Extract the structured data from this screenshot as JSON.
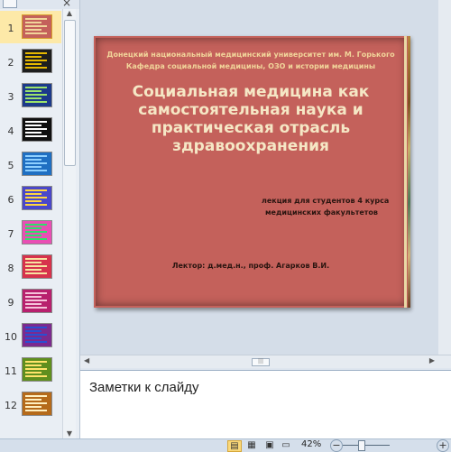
{
  "slides_pane": {
    "close_label": "×",
    "slides": [
      {
        "number": "1",
        "selected": true,
        "colors": [
          "#c4615b",
          "#f1d59a"
        ]
      },
      {
        "number": "2",
        "selected": false,
        "colors": [
          "#1e1e1e",
          "#e6b800"
        ]
      },
      {
        "number": "3",
        "selected": false,
        "colors": [
          "#1c3a8a",
          "#9be36b"
        ]
      },
      {
        "number": "4",
        "selected": false,
        "colors": [
          "#101010",
          "#ffffff"
        ]
      },
      {
        "number": "5",
        "selected": false,
        "colors": [
          "#1f6fc2",
          "#8fd0ff"
        ]
      },
      {
        "number": "6",
        "selected": false,
        "colors": [
          "#4a47c9",
          "#ffd53f"
        ]
      },
      {
        "number": "7",
        "selected": false,
        "colors": [
          "#e94fb4",
          "#2ee06a"
        ]
      },
      {
        "number": "8",
        "selected": false,
        "colors": [
          "#d7324c",
          "#f7e3a1"
        ]
      },
      {
        "number": "9",
        "selected": false,
        "colors": [
          "#b8206e",
          "#f5c2da"
        ]
      },
      {
        "number": "10",
        "selected": false,
        "colors": [
          "#7b2a8f",
          "#2a4fd0"
        ]
      },
      {
        "number": "11",
        "selected": false,
        "colors": [
          "#5f8f1e",
          "#ffe36b"
        ]
      },
      {
        "number": "12",
        "selected": false,
        "colors": [
          "#b56a1a",
          "#fff0c2"
        ]
      }
    ]
  },
  "slide": {
    "institution_line1": "Донецкий национальный  медицинский университет им. М. Горького",
    "institution_line2": "Кафедра социальной медицины, ОЗО и истории медицины",
    "title_line1": "Социальная медицина как",
    "title_line2": "самостоятельная наука и",
    "title_line3": "практическая отрасль",
    "title_line4": "здравоохранения",
    "lecture_line1": "лекция для  студентов 4 курса",
    "lecture_line2": "медицинских  факультетов",
    "lector": "Лектор: д.мед.н., проф.  Агарков В.И.",
    "background_color": "#c4615b"
  },
  "notes": {
    "placeholder": "Заметки к слайду"
  },
  "status_bar": {
    "zoom_level": "42%",
    "zoom_minus": "−",
    "zoom_plus": "+"
  }
}
